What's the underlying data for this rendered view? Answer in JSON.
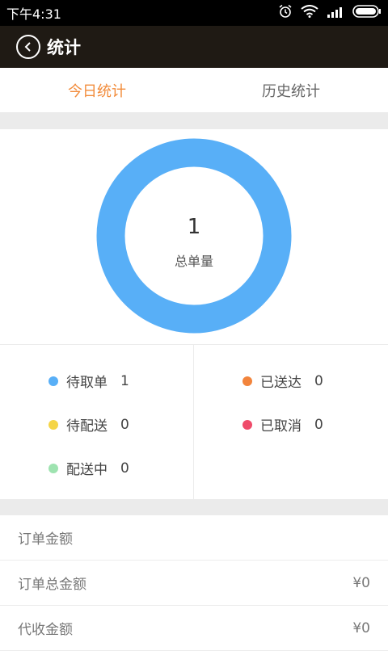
{
  "status_bar": {
    "time": "下午4:31",
    "icons": [
      "alarm-icon",
      "wifi-icon",
      "signal-icon",
      "battery-icon"
    ]
  },
  "header": {
    "title": "统计",
    "back_icon": "back-circle-icon"
  },
  "tabs": [
    {
      "label": "今日统计",
      "active": true
    },
    {
      "label": "历史统计",
      "active": false
    }
  ],
  "summary": {
    "total_value": "1",
    "total_label": "总单量",
    "ring_color": "#58aff7"
  },
  "legend": {
    "left": [
      {
        "label": "待取单",
        "value": "1",
        "color": "#58aff7"
      },
      {
        "label": "待配送",
        "value": "0",
        "color": "#f5d547"
      },
      {
        "label": "配送中",
        "value": "0",
        "color": "#9ee3b0"
      }
    ],
    "right": [
      {
        "label": "已送达",
        "value": "0",
        "color": "#f2843c"
      },
      {
        "label": "已取消",
        "value": "0",
        "color": "#ef4b6a"
      }
    ]
  },
  "amounts": {
    "section_title": "订单金额",
    "rows": [
      {
        "label": "订单总金额",
        "value": "¥0"
      },
      {
        "label": "代收金额",
        "value": "¥0"
      }
    ]
  }
}
